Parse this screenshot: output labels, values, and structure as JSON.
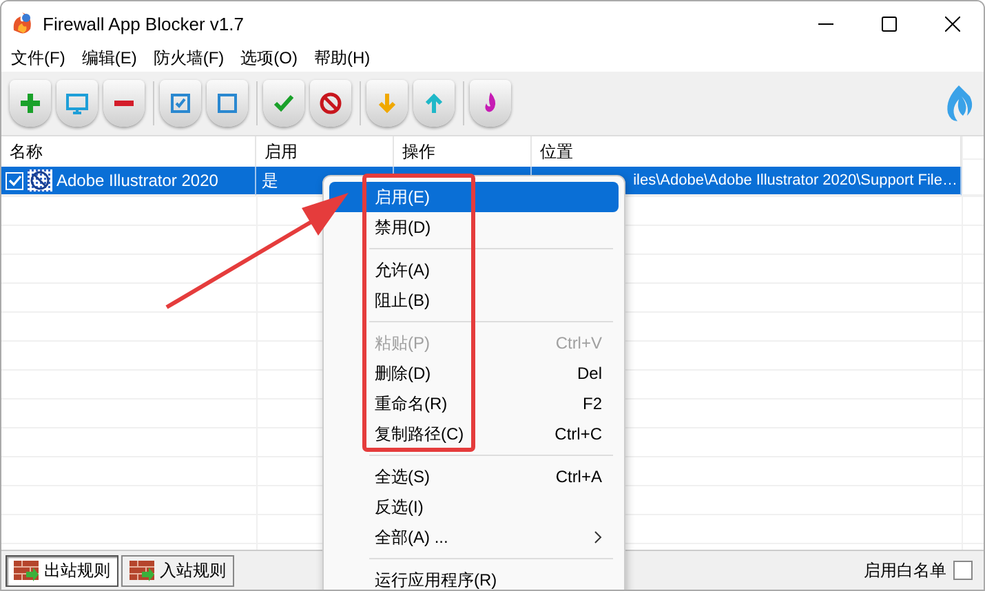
{
  "window": {
    "title": "Firewall App Blocker v1.7"
  },
  "menubar": [
    {
      "label": "文件(F)"
    },
    {
      "label": "编辑(E)"
    },
    {
      "label": "防火墙(F)"
    },
    {
      "label": "选项(O)"
    },
    {
      "label": "帮助(H)"
    }
  ],
  "table": {
    "columns": [
      "名称",
      "启用",
      "操作",
      "位置"
    ],
    "rows": [
      {
        "checked": true,
        "selected": true,
        "name": "Adobe Illustrator 2020",
        "enabled": "是",
        "location": "iles\\Adobe\\Adobe Illustrator 2020\\Support File…"
      }
    ]
  },
  "context_menu": {
    "groups": [
      [
        {
          "kind": "item",
          "label": "启用(E)",
          "selected": true,
          "disabled": false
        },
        {
          "kind": "item",
          "label": "禁用(D)",
          "selected": false,
          "disabled": false
        }
      ],
      [
        {
          "kind": "item",
          "label": "允许(A)",
          "selected": false,
          "disabled": false
        },
        {
          "kind": "item",
          "label": "阻止(B)",
          "selected": false,
          "disabled": false
        }
      ],
      [
        {
          "kind": "item",
          "label": "粘贴(P)",
          "shortcut": "Ctrl+V",
          "selected": false,
          "disabled": true
        },
        {
          "kind": "item",
          "label": "删除(D)",
          "shortcut": "Del",
          "selected": false,
          "disabled": false
        },
        {
          "kind": "item",
          "label": "重命名(R)",
          "shortcut": "F2",
          "selected": false,
          "disabled": false
        },
        {
          "kind": "item",
          "label": "复制路径(C)",
          "shortcut": "Ctrl+C",
          "selected": false,
          "disabled": false
        }
      ],
      [
        {
          "kind": "item",
          "label": "全选(S)",
          "shortcut": "Ctrl+A",
          "selected": false,
          "disabled": false
        },
        {
          "kind": "item",
          "label": "反选(I)",
          "selected": false,
          "disabled": false
        },
        {
          "kind": "submenu",
          "label": "全部(A) ...",
          "selected": false,
          "disabled": false
        }
      ],
      [
        {
          "kind": "item",
          "label": "运行应用程序(R)",
          "selected": false,
          "disabled": false
        }
      ]
    ]
  },
  "status_bar": {
    "tabs": [
      {
        "label": "出站规则",
        "selected": true
      },
      {
        "label": "入站规则",
        "selected": false
      }
    ],
    "whitelist": {
      "label": "启用白名单",
      "checked": false
    }
  }
}
